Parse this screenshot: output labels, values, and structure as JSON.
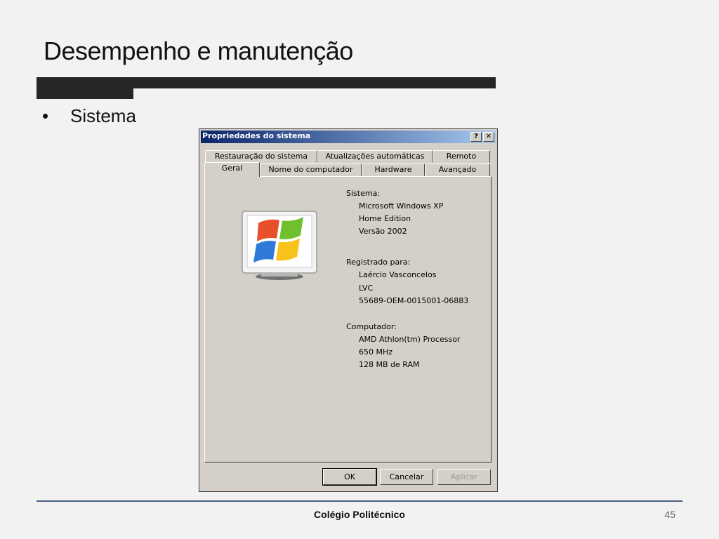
{
  "slide": {
    "title": "Desempenho e manutenção",
    "bullet_symbol": "•",
    "bullet_text": "Sistema",
    "footer": "Colégio Politécnico",
    "page_number": "45"
  },
  "dialog": {
    "title": "Propriedades do sistema",
    "help_button": "?",
    "close_button": "✕",
    "tabs_back": [
      "Restauração do sistema",
      "Atualizações automáticas",
      "Remoto"
    ],
    "tabs_front": [
      "Geral",
      "Nome do computador",
      "Hardware",
      "Avançado"
    ],
    "active_tab": "Geral",
    "sistema_label": "Sistema:",
    "sistema_lines": [
      "Microsoft Windows XP",
      "Home Edition",
      "Versão 2002"
    ],
    "registrado_label": "Registrado para:",
    "registrado_lines": [
      "Laércio Vasconcelos",
      "LVC",
      "55689-OEM-0015001-06883"
    ],
    "computador_label": "Computador:",
    "computador_lines": [
      "AMD Athlon(tm) Processor",
      "650 MHz",
      "128 MB de RAM"
    ],
    "buttons": {
      "ok": "OK",
      "cancel": "Cancelar",
      "apply": "Aplicar"
    },
    "icon": "windows-xp-monitor-icon"
  }
}
